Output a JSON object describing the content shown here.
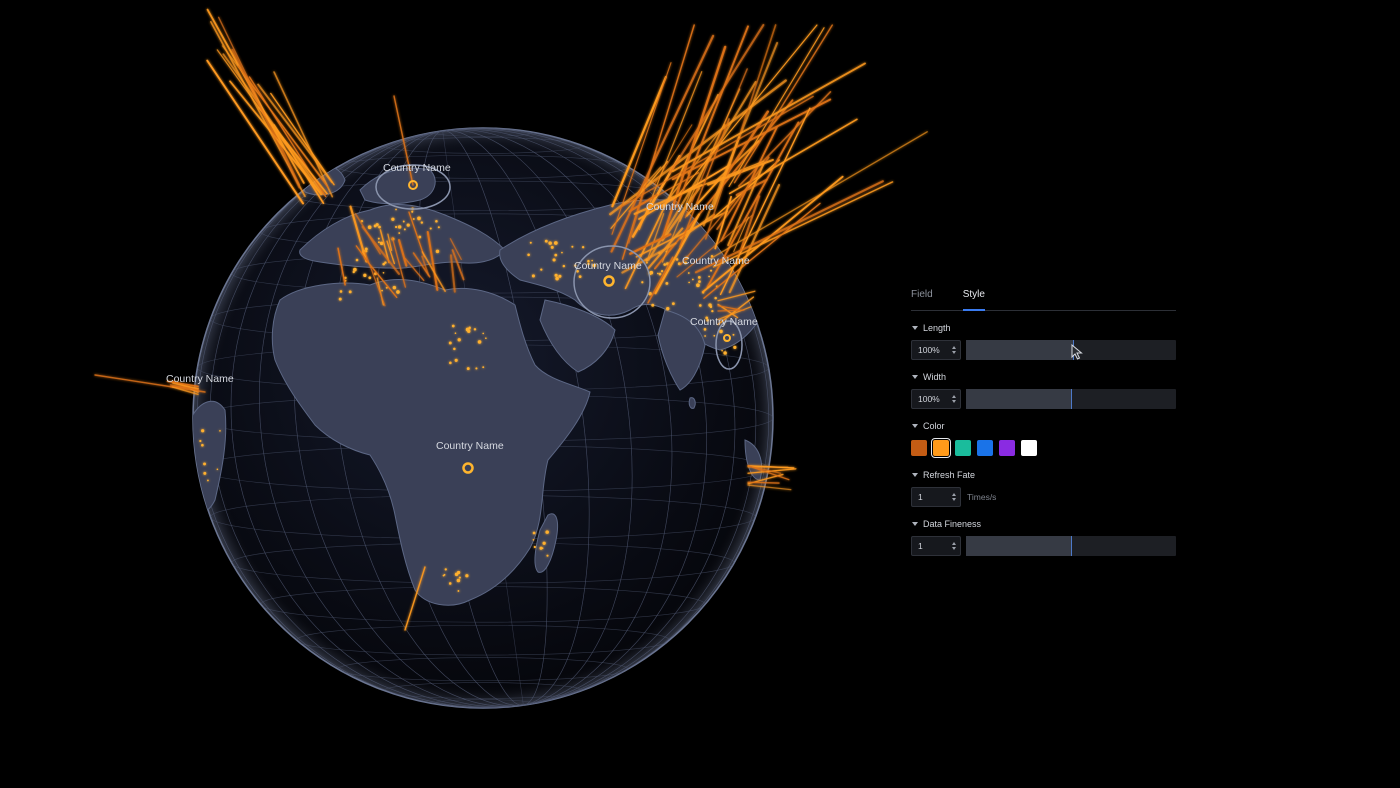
{
  "globe": {
    "labels": [
      {
        "text": "Country Name"
      },
      {
        "text": "Country Name"
      },
      {
        "text": "Country Name"
      },
      {
        "text": "Country Name"
      },
      {
        "text": "Country Name"
      },
      {
        "text": "Country Name"
      },
      {
        "text": "Country Name"
      }
    ],
    "colors": {
      "spike": "#ff9a1f",
      "spike_dim": "#e07318",
      "land": "#3c4259",
      "ocean": "#0d1020",
      "grid": "#515a73"
    }
  },
  "panel": {
    "tabs": [
      {
        "label": "Field",
        "active": false
      },
      {
        "label": "Style",
        "active": true
      }
    ],
    "length": {
      "label": "Length",
      "value": "100%",
      "level": 0.51
    },
    "width": {
      "label": "Width",
      "value": "100%",
      "level": 0.5
    },
    "color": {
      "label": "Color",
      "swatches": [
        "#c45c14",
        "#ff9a1a",
        "#1abc9c",
        "#1a73e8",
        "#8a2be2",
        "#ffffff"
      ],
      "selected_index": 1
    },
    "refresh_rate": {
      "label": "Refresh Fate",
      "value": "1",
      "unit": "Times/s"
    },
    "data_fineness": {
      "label": "Data Fineness",
      "value": "1",
      "level": 0.5
    },
    "accent": "#3a7bf0"
  }
}
